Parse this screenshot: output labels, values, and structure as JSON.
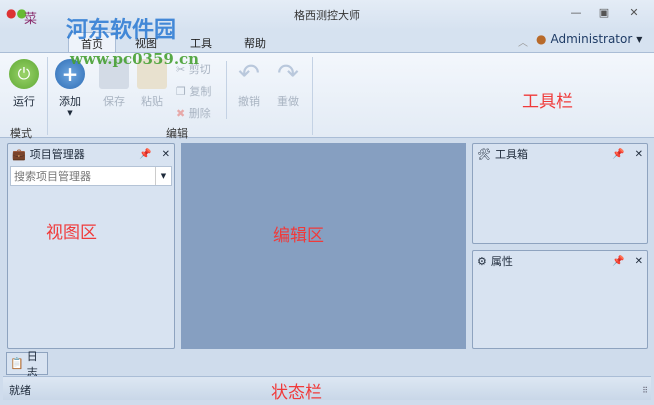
{
  "window": {
    "title": "格西测控大师",
    "minimize": "—",
    "maximize": "▣",
    "close": "✕"
  },
  "app_menu": {
    "label": "菜单"
  },
  "watermark": {
    "name": "河东软件园",
    "url": "www.pc0359.cn"
  },
  "tabs": [
    {
      "label": "首页",
      "active": true
    },
    {
      "label": "视图"
    },
    {
      "label": "工具"
    },
    {
      "label": "帮助"
    }
  ],
  "user": {
    "name": "Administrator"
  },
  "ribbon": {
    "groups": [
      {
        "label": "模式",
        "buttons": [
          {
            "label": "运行"
          }
        ]
      },
      {
        "label": "编辑",
        "buttons": [
          {
            "label": "添加"
          },
          {
            "label": "保存"
          },
          {
            "label": "粘贴"
          },
          {
            "label": "剪切"
          },
          {
            "label": "复制"
          },
          {
            "label": "删除"
          },
          {
            "label": "撤销"
          },
          {
            "label": "重做"
          }
        ]
      }
    ]
  },
  "panels": {
    "project": {
      "title": "项目管理器",
      "search_placeholder": "搜索项目管理器"
    },
    "toolbox": {
      "title": "工具箱"
    },
    "properties": {
      "title": "属性"
    }
  },
  "bottom_tab": {
    "label": "日志"
  },
  "status": {
    "text": "就绪"
  },
  "annotations": {
    "toolbar": "工具栏",
    "view": "视图区",
    "editor": "编辑区",
    "statusbar": "状态栏"
  },
  "colors": {
    "editor_bg": "#869fc1",
    "annotation": "#f03a3a"
  }
}
